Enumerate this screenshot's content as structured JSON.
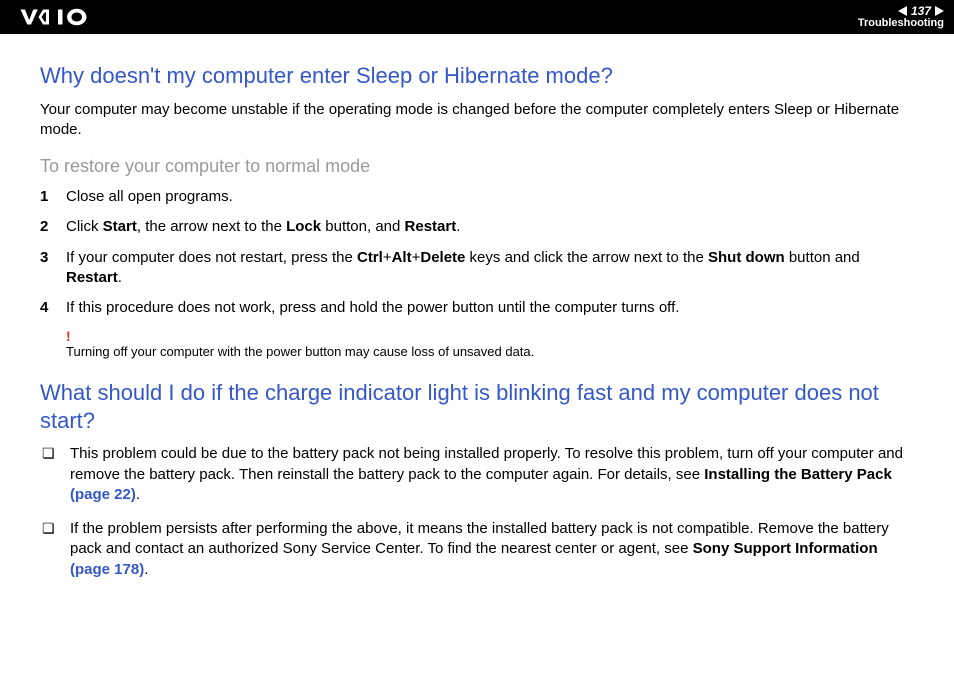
{
  "header": {
    "page_number": "137",
    "section": "Troubleshooting"
  },
  "q1": {
    "title": "Why doesn't my computer enter Sleep or Hibernate mode?",
    "intro": "Your computer may become unstable if the operating mode is changed before the computer completely enters Sleep or Hibernate mode.",
    "subhead": "To restore your computer to normal mode",
    "steps": [
      {
        "n": "1",
        "text_plain": "Close all open programs."
      },
      {
        "n": "2",
        "prefix": "Click ",
        "b1": "Start",
        "mid1": ", the arrow next to the ",
        "b2": "Lock",
        "mid2": " button, and ",
        "b3": "Restart",
        "suffix": "."
      },
      {
        "n": "3",
        "prefix": "If your computer does not restart, press the ",
        "b1": "Ctrl",
        "plus1": "+",
        "b2": "Alt",
        "plus2": "+",
        "b3": "Delete",
        "mid": " keys and click the arrow next to the ",
        "b4": "Shut down",
        "mid2": " button and ",
        "b5": "Restart",
        "suffix": "."
      },
      {
        "n": "4",
        "text_plain": "If this procedure does not work, press and hold the power button until the computer turns off."
      }
    ],
    "warn_symbol": "!",
    "warn_text": "Turning off your computer with the power button may cause loss of unsaved data."
  },
  "q2": {
    "title": "What should I do if the charge indicator light is blinking fast and my computer does not start?",
    "bullets": [
      {
        "prefix": "This problem could be due to the battery pack not being installed properly. To resolve this problem, turn off your computer and remove the battery pack. Then reinstall the battery pack to the computer again. For details, see ",
        "bold": "Installing the Battery Pack ",
        "link": "(page 22)",
        "suffix": "."
      },
      {
        "prefix": "If the problem persists after performing the above, it means the installed battery pack is not compatible. Remove the battery pack and contact an authorized Sony Service Center. To find the nearest center or agent, see ",
        "bold": "Sony Support Information ",
        "link": "(page 178)",
        "suffix": "."
      }
    ]
  }
}
